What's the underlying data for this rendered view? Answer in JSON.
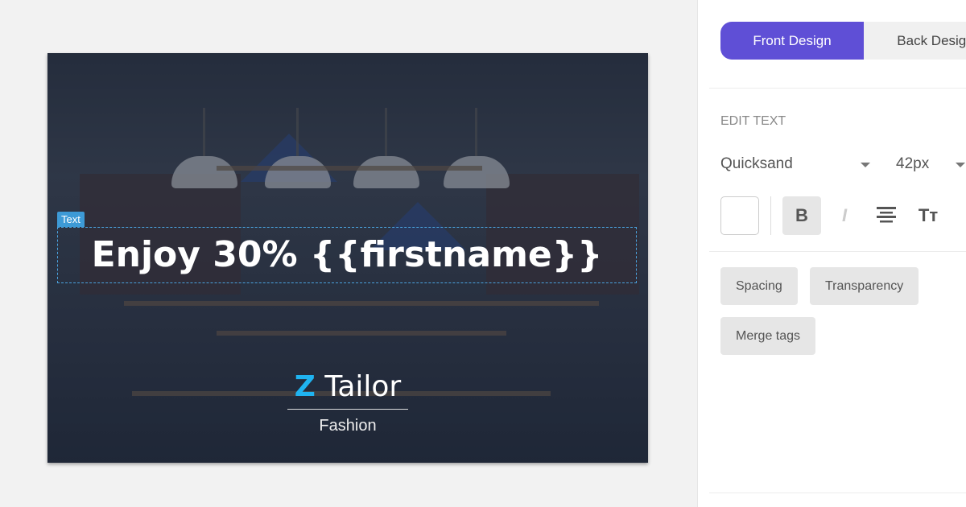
{
  "card": {
    "selection_tag": "Text",
    "headline": "Enjoy 30% {{firstname}}",
    "logo_mark": "Z",
    "logo_text": "Tailor",
    "tagline": "Fashion",
    "accent": "#1fb3f0"
  },
  "panel": {
    "tabs": [
      {
        "label": "Front Design",
        "active": true
      },
      {
        "label": "Back Design",
        "active": false
      }
    ],
    "section_label": "EDIT TEXT",
    "font": "Quicksand",
    "size": "42px",
    "text_color": "#ffffff",
    "format": {
      "bold": "B",
      "italic": "I",
      "align_icon": "align-center-icon",
      "case_icon": "Tт"
    },
    "buttons": [
      "Spacing",
      "Transparency",
      "Merge tags"
    ],
    "accent": "#5f4fd6"
  }
}
